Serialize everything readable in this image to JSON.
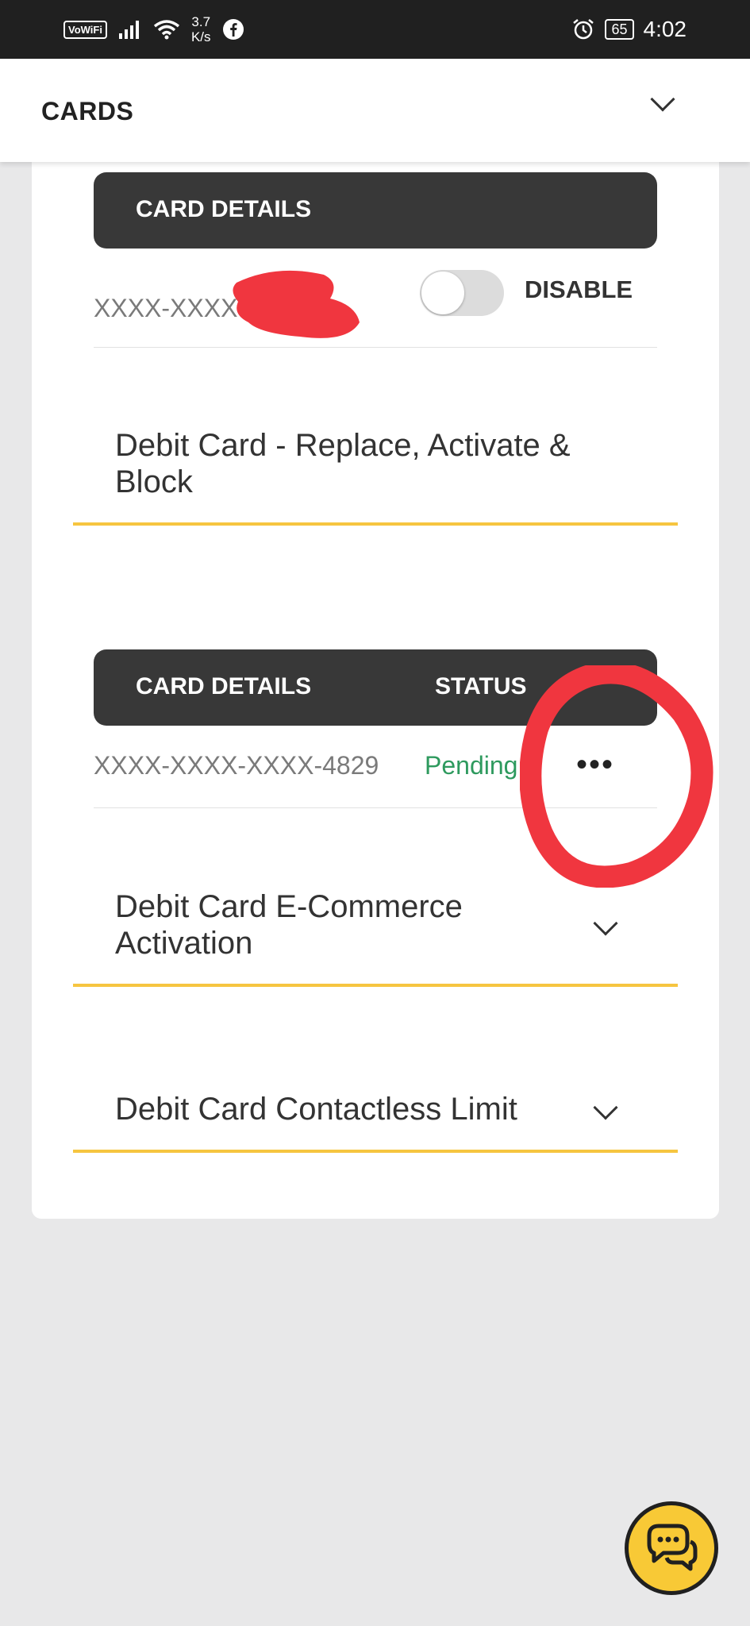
{
  "statusbar": {
    "vowifi": "VoWiFi",
    "speed_value": "3.7",
    "speed_unit": "K/s",
    "battery": "65",
    "time": "4:02"
  },
  "header": {
    "title": "CARDS"
  },
  "card_block_1": {
    "column_header": "CARD DETAILS",
    "card_number": "XXXX-XXXX-XX",
    "toggle_label": "DISABLE"
  },
  "sections": {
    "replace": "Debit Card - Replace, Activate & Block",
    "ecommerce": "Debit Card E-Commerce Activation",
    "contactless": "Debit Card Contactless Limit"
  },
  "card_block_2": {
    "column_header": "CARD DETAILS",
    "status_header": "STATUS",
    "card_number": "XXXX-XXXX-XXXX-4829",
    "status": "Pending",
    "more": "•••"
  },
  "colors": {
    "accent_yellow": "#f6c540",
    "pending_green": "#2e9a5e",
    "header_dark": "#383838",
    "annotation_red": "#f0363f"
  }
}
